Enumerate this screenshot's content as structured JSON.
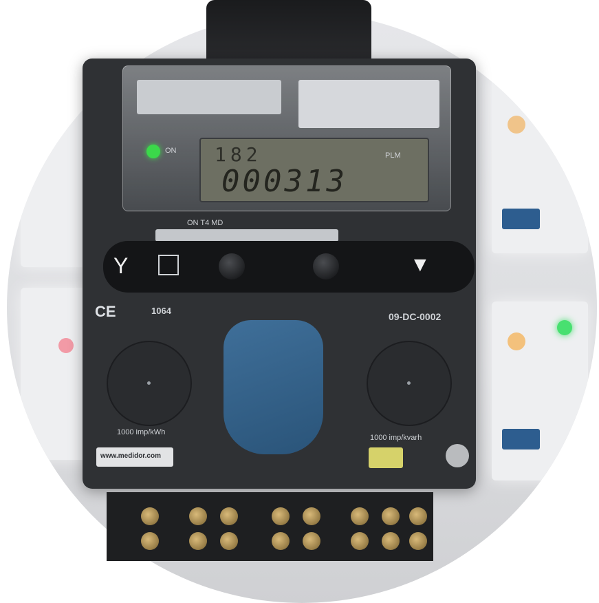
{
  "meter": {
    "on_label": "ON",
    "lcd_top": "182",
    "lcd_main": "000313",
    "plm_label": "PLM",
    "buttons_label": "ON T4 MD",
    "brand_label": "www.medidor.com",
    "ce_text": "CE",
    "left_cert": "1064",
    "right_cert": "09-DC-0002",
    "left_rate": "1000 imp/kWh",
    "right_rate": "1000 imp/kvarh"
  },
  "colors": {
    "on_led": "#3bd84a",
    "meter_body": "#2f3134",
    "blue_cap": "#2f5c85"
  }
}
